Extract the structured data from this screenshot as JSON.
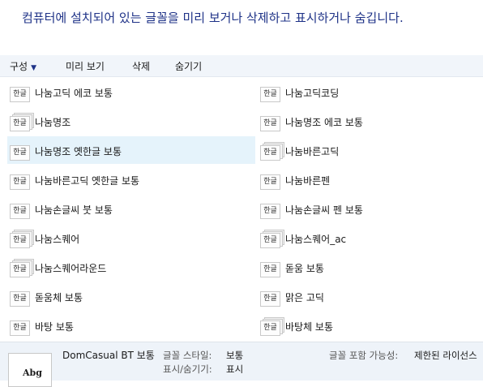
{
  "header": {
    "description": "컴퓨터에 설치되어 있는 글꼴을 미리 보거나 삭제하고 표시하거나 숨깁니다."
  },
  "toolbar": {
    "organize_label": "구성",
    "preview_label": "미리 보기",
    "delete_label": "삭제",
    "hide_label": "숨기기"
  },
  "fonts": {
    "left": [
      {
        "label": "나눔고딕 에코 보통",
        "icon_text": "한글"
      },
      {
        "label": "나눔명조",
        "icon_text": "한글"
      },
      {
        "label": "나눔명조 옛한글 보통",
        "icon_text": "한글"
      },
      {
        "label": "나눔바른고딕 옛한글 보통",
        "icon_text": "한글"
      },
      {
        "label": "나눔손글씨 붓 보통",
        "icon_text": "한글"
      },
      {
        "label": "나눔스퀘어",
        "icon_text": "한글"
      },
      {
        "label": "나눔스퀘어라운드",
        "icon_text": "한글"
      },
      {
        "label": "돋움체 보통",
        "icon_text": "한글"
      },
      {
        "label": "바탕 보통",
        "icon_text": "한글"
      }
    ],
    "right": [
      {
        "label": "나눔고딕코딩",
        "icon_text": "한글"
      },
      {
        "label": "나눔명조 에코 보통",
        "icon_text": "한글"
      },
      {
        "label": "나눔바른고딕",
        "icon_text": "한글"
      },
      {
        "label": "나눔바른펜",
        "icon_text": "한글"
      },
      {
        "label": "나눔손글씨 펜 보통",
        "icon_text": "한글"
      },
      {
        "label": "나눔스퀘어_ac",
        "icon_text": "한글"
      },
      {
        "label": "돋움 보통",
        "icon_text": "한글"
      },
      {
        "label": "맑은 고딕",
        "icon_text": "한글"
      },
      {
        "label": "바탕체 보통",
        "icon_text": "한글"
      }
    ]
  },
  "details": {
    "font_name": "DomCasual BT 보통",
    "preview_text": "Abg",
    "style_label": "글꼴 스타일:",
    "style_value": "보통",
    "visibility_label": "표시/숨기기:",
    "visibility_value": "표시",
    "embed_label": "글꼴 포함 가능성:",
    "embed_value": "제한된 라이선스"
  },
  "colors": {
    "accent": "#1e3287",
    "toolbar_bg": "#f1f5fa",
    "selected_bg": "#e5f3fb",
    "details_bg": "#eef3f9"
  }
}
